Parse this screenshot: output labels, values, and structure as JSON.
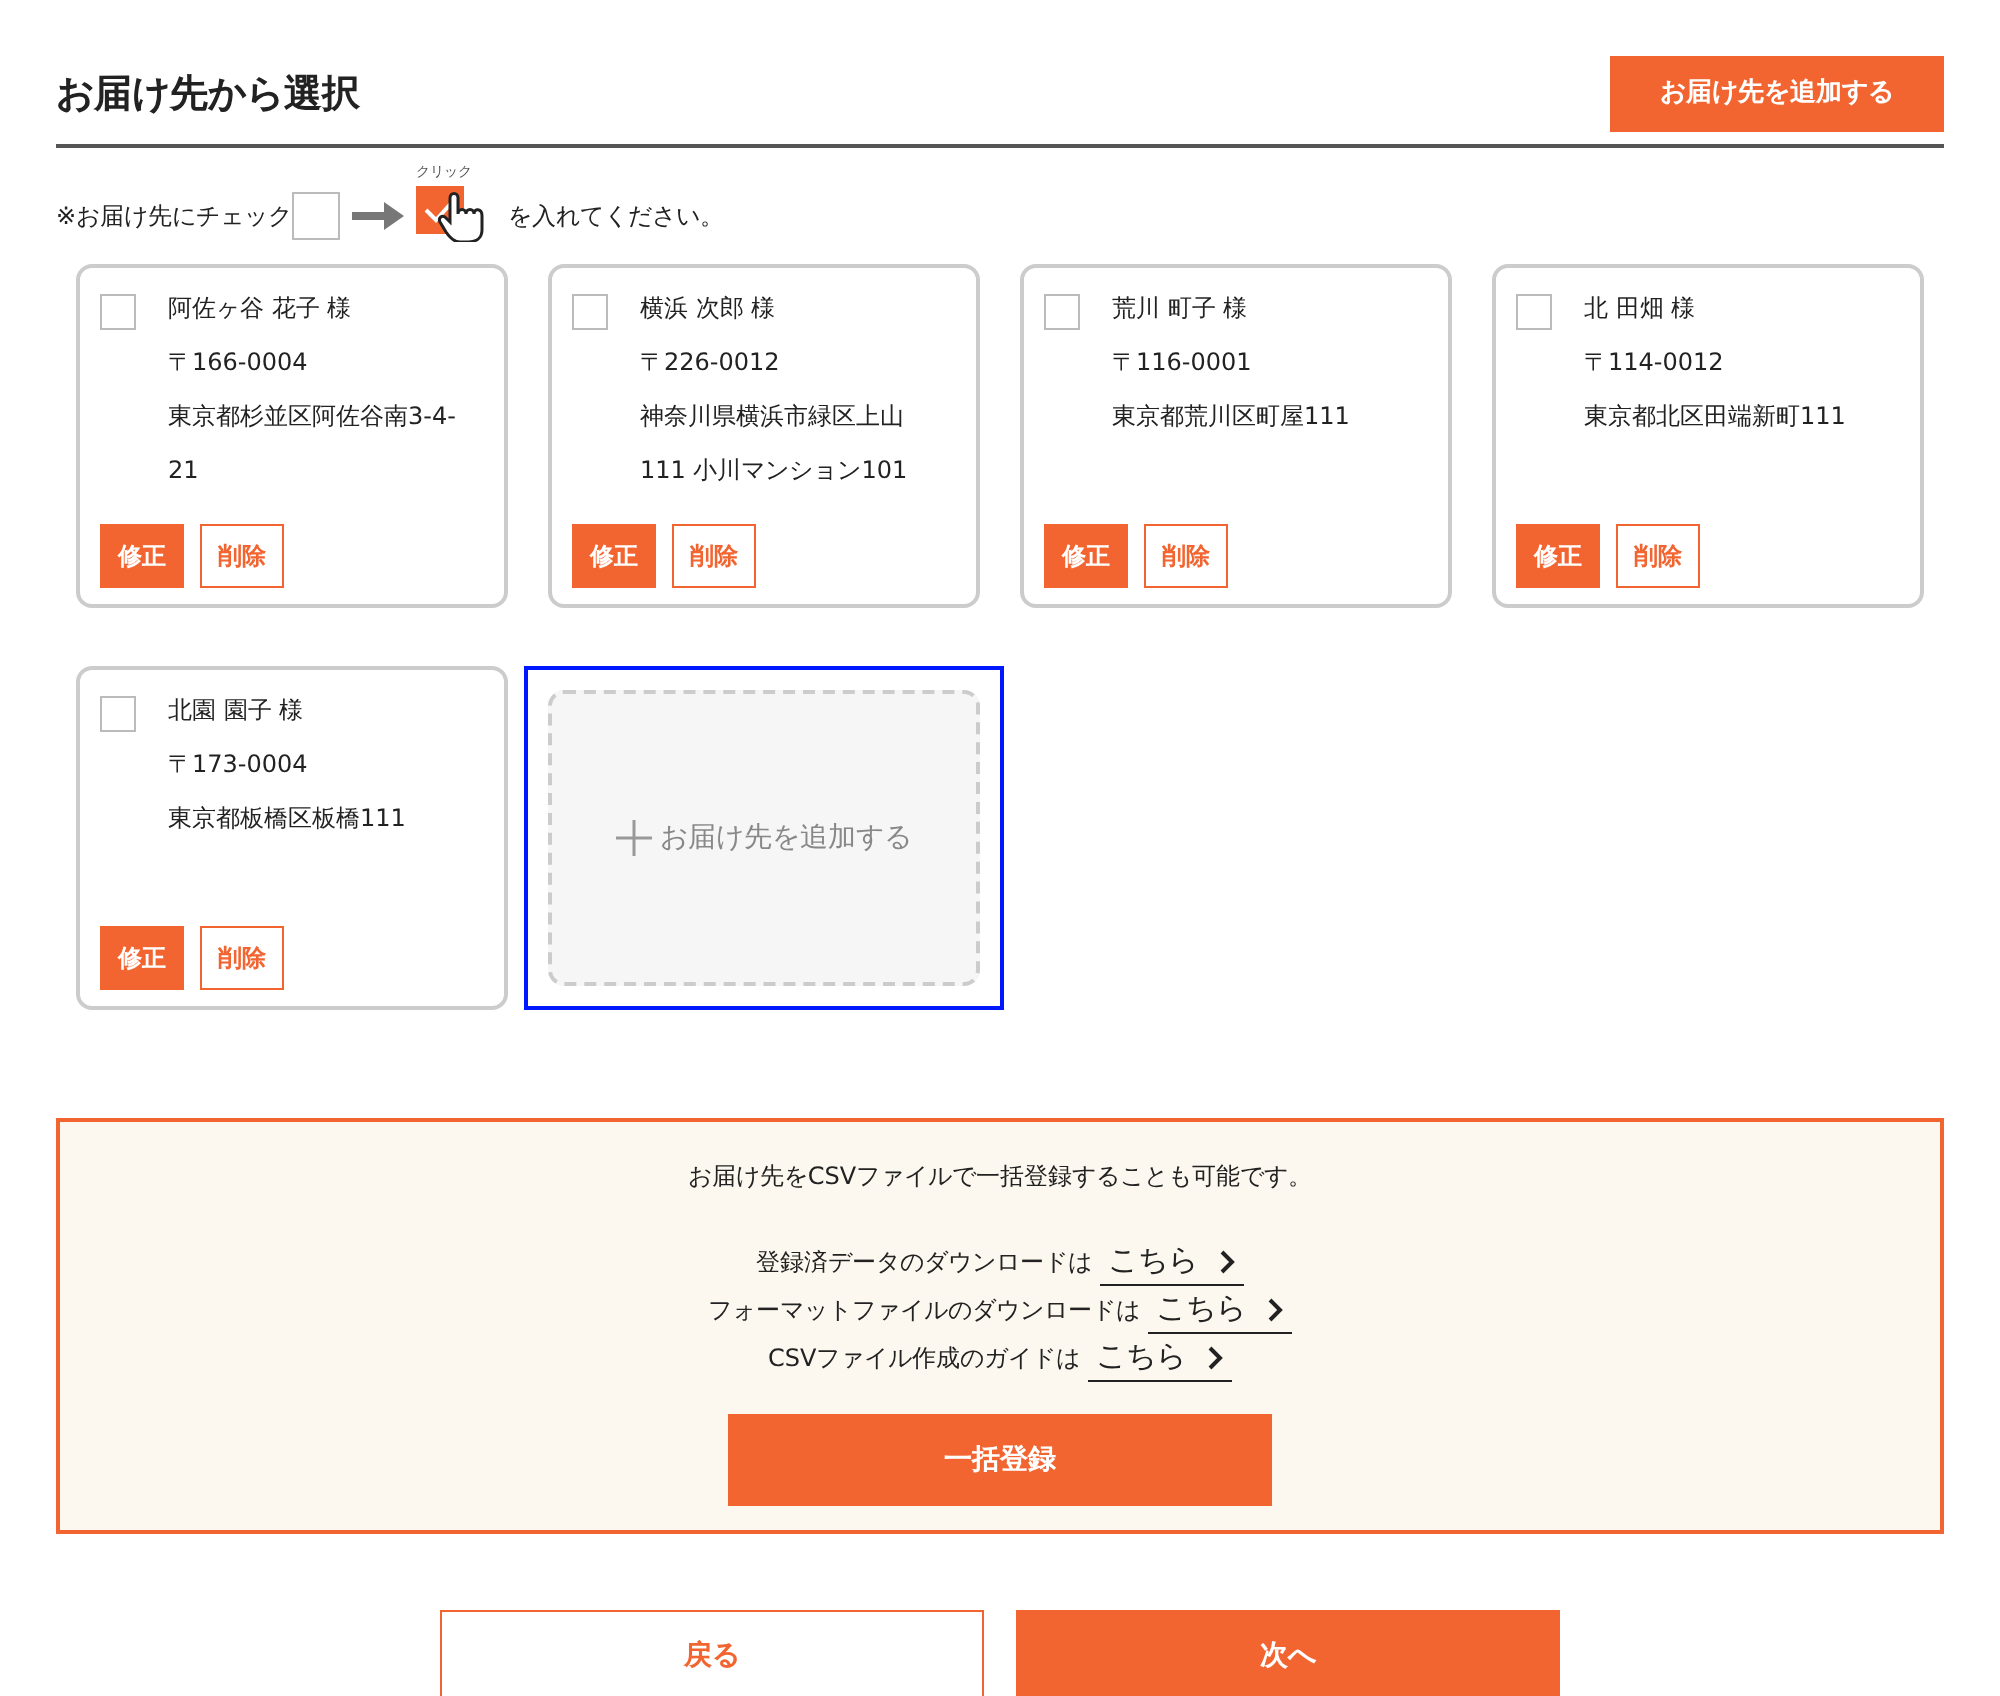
{
  "header": {
    "title": "お届け先から選択",
    "add_button": "お届け先を追加する"
  },
  "instruction": {
    "before": "※お届け先にチェック",
    "click_label": "クリック",
    "after": "を入れてください。"
  },
  "addresses": [
    {
      "name": "阿佐ヶ谷 花子 様",
      "postal": "〒166-0004",
      "address": "東京都杉並区阿佐谷南3-4-21",
      "checked": false,
      "edit": "修正",
      "delete": "削除"
    },
    {
      "name": "横浜 次郎 様",
      "postal": "〒226-0012",
      "address": "神奈川県横浜市緑区上山111 小川マンション101",
      "checked": false,
      "edit": "修正",
      "delete": "削除"
    },
    {
      "name": "荒川 町子 様",
      "postal": "〒116-0001",
      "address": "東京都荒川区町屋111",
      "checked": false,
      "edit": "修正",
      "delete": "削除"
    },
    {
      "name": "北 田畑 様",
      "postal": "〒114-0012",
      "address": "東京都北区田端新町111",
      "checked": false,
      "edit": "修正",
      "delete": "削除"
    },
    {
      "name": "北園 園子 様",
      "postal": "〒173-0004",
      "address": "東京都板橋区板橋111",
      "checked": false,
      "edit": "修正",
      "delete": "削除"
    }
  ],
  "add_card": {
    "label": "お届け先を追加する",
    "highlighted": true
  },
  "csv": {
    "intro": "お届け先をCSVファイルで一括登録することも可能です。",
    "links": [
      {
        "text": "登録済データのダウンロードは",
        "link": "こちら"
      },
      {
        "text": "フォーマットファイルのダウンロードは",
        "link": "こちら"
      },
      {
        "text": "CSVファイル作成のガイドは",
        "link": "こちら"
      }
    ],
    "button": "一括登録"
  },
  "footer": {
    "back": "戻る",
    "next": "次へ"
  }
}
